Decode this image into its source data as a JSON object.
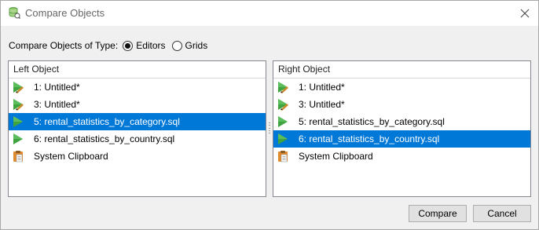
{
  "window": {
    "title": "Compare Objects",
    "title_icon": "database-compare-icon",
    "close_icon": "close-icon"
  },
  "type_selector": {
    "label": "Compare Objects of Type:",
    "options": [
      {
        "label": "Editors",
        "selected": true
      },
      {
        "label": "Grids",
        "selected": false
      }
    ]
  },
  "left_panel": {
    "header": "Left Object",
    "items": [
      {
        "label": "1: Untitled*",
        "icon": "editor-modified-icon"
      },
      {
        "label": "3: Untitled*",
        "icon": "editor-modified-icon"
      },
      {
        "label": "5: rental_statistics_by_category.sql",
        "icon": "editor-icon",
        "selected": true
      },
      {
        "label": "6: rental_statistics_by_country.sql",
        "icon": "editor-icon"
      },
      {
        "label": "System Clipboard",
        "icon": "clipboard-icon"
      }
    ]
  },
  "right_panel": {
    "header": "Right Object",
    "items": [
      {
        "label": "1: Untitled*",
        "icon": "editor-modified-icon"
      },
      {
        "label": "3: Untitled*",
        "icon": "editor-modified-icon"
      },
      {
        "label": "5: rental_statistics_by_category.sql",
        "icon": "editor-icon"
      },
      {
        "label": "6: rental_statistics_by_country.sql",
        "icon": "editor-icon",
        "selected": true
      },
      {
        "label": "System Clipboard",
        "icon": "clipboard-icon"
      }
    ]
  },
  "buttons": {
    "compare": "Compare",
    "cancel": "Cancel"
  },
  "colors": {
    "selection": "#0078d7",
    "icon_green": "#3fa33f",
    "clipboard_orange": "#e08a2e"
  }
}
